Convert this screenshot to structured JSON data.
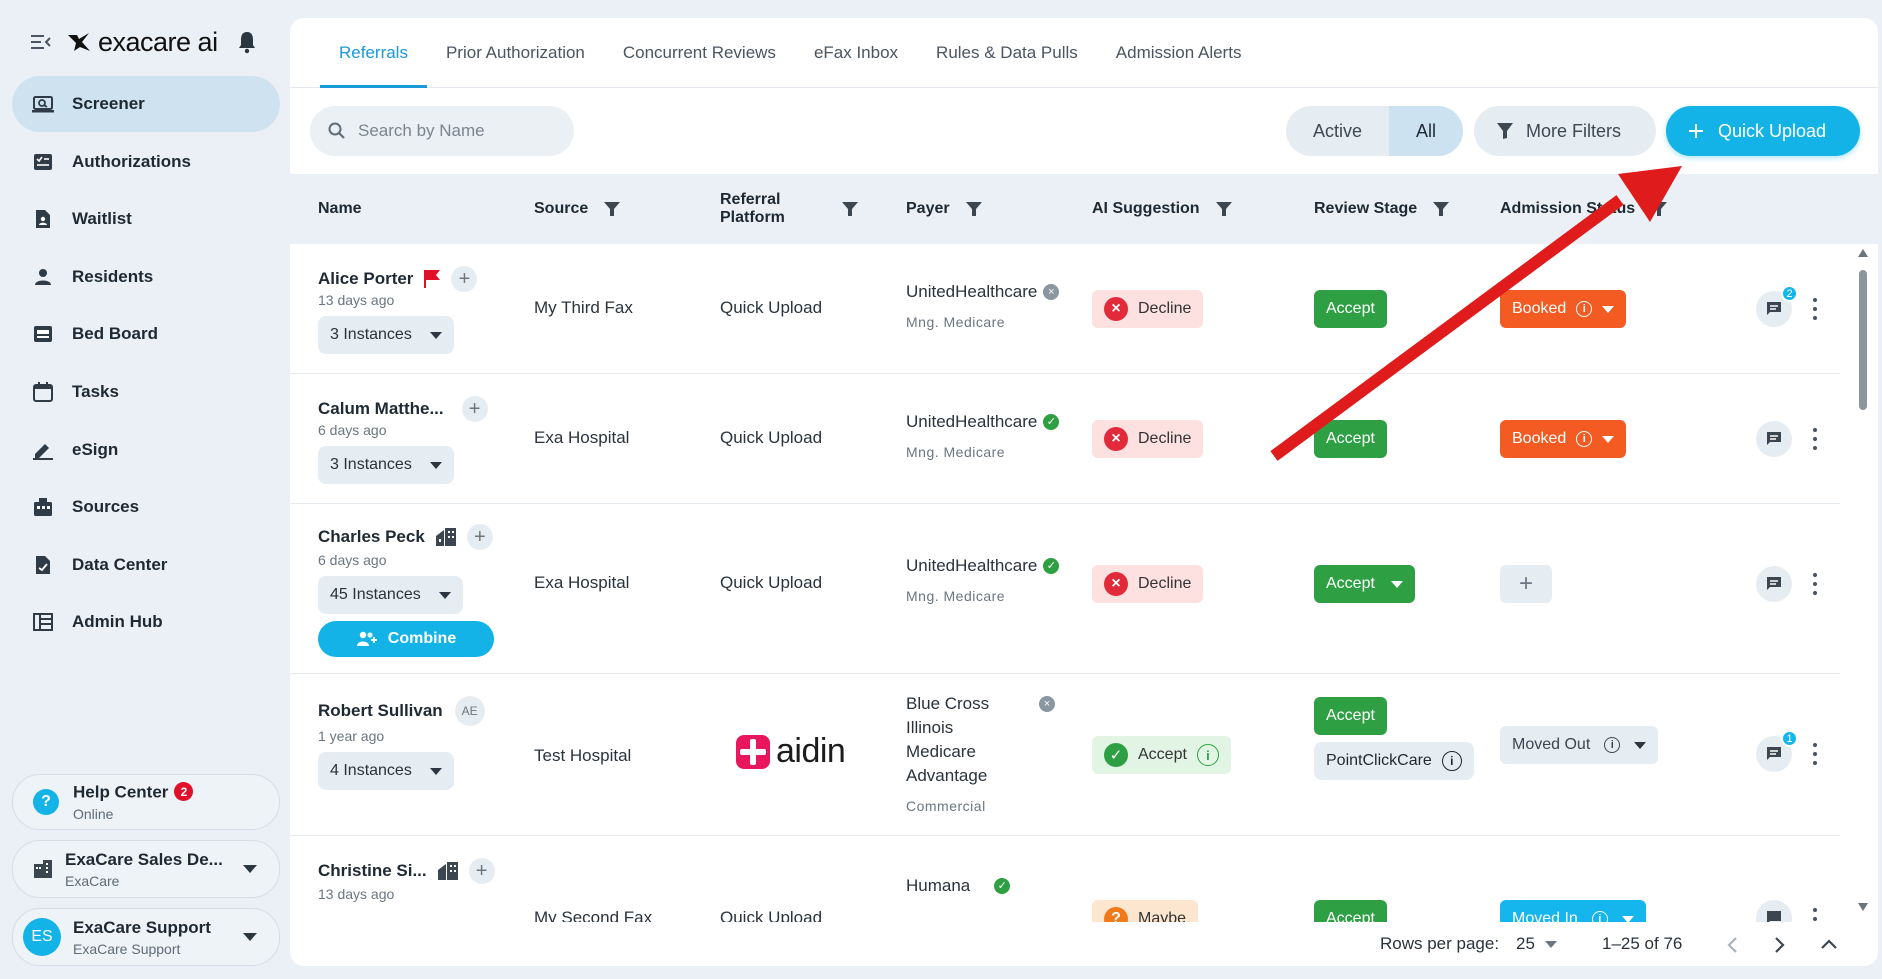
{
  "app": {
    "brand": "exacare ai"
  },
  "sidebar": {
    "items": [
      {
        "label": "Screener",
        "icon": "screener-icon"
      },
      {
        "label": "Authorizations",
        "icon": "authorizations-icon"
      },
      {
        "label": "Waitlist",
        "icon": "waitlist-icon"
      },
      {
        "label": "Residents",
        "icon": "residents-icon"
      },
      {
        "label": "Bed Board",
        "icon": "bed-board-icon"
      },
      {
        "label": "Tasks",
        "icon": "tasks-icon"
      },
      {
        "label": "eSign",
        "icon": "esign-icon"
      },
      {
        "label": "Sources",
        "icon": "sources-icon"
      },
      {
        "label": "Data Center",
        "icon": "data-center-icon"
      },
      {
        "label": "Admin Hub",
        "icon": "admin-hub-icon"
      }
    ],
    "help": {
      "title": "Help Center",
      "badge": "2",
      "status": "Online"
    },
    "org": {
      "title": "ExaCare Sales De...",
      "sub": "ExaCare"
    },
    "user": {
      "initials": "ES",
      "title": "ExaCare Support",
      "sub": "ExaCare Support"
    }
  },
  "tabs": [
    "Referrals",
    "Prior Authorization",
    "Concurrent Reviews",
    "eFax Inbox",
    "Rules & Data Pulls",
    "Admission Alerts"
  ],
  "toolbar": {
    "search_placeholder": "Search by Name",
    "seg_active": "Active",
    "seg_all": "All",
    "more_filters": "More Filters",
    "quick_upload": "Quick Upload"
  },
  "table": {
    "headers": {
      "name": "Name",
      "source": "Source",
      "platform": "Referral Platform",
      "payer": "Payer",
      "ai": "AI Suggestion",
      "stage": "Review Stage",
      "admission": "Admission Status"
    },
    "rows": [
      {
        "name": "Alice Porter",
        "ago": "13 days ago",
        "instances": "3 Instances",
        "source": "My Third Fax",
        "platform": "Quick Upload",
        "payer": "UnitedHealthcare",
        "payer_sub": "Mng. Medicare",
        "ai": "Decline",
        "stage": "Accept",
        "admission": "Booked",
        "comments": "2"
      },
      {
        "name": "Calum Matthe...",
        "ago": "6 days ago",
        "instances": "3 Instances",
        "source": "Exa Hospital",
        "platform": "Quick Upload",
        "payer": "UnitedHealthcare",
        "payer_sub": "Mng. Medicare",
        "ai": "Decline",
        "stage": "Accept",
        "admission": "Booked"
      },
      {
        "name": "Charles Peck",
        "ago": "6 days ago",
        "instances": "45 Instances",
        "combine": "Combine",
        "source": "Exa Hospital",
        "platform": "Quick Upload",
        "payer": "UnitedHealthcare",
        "payer_sub": "Mng. Medicare",
        "ai": "Decline",
        "stage": "Accept"
      },
      {
        "name": "Robert Sullivan",
        "badge": "AE",
        "ago": "1 year ago",
        "instances": "4 Instances",
        "source": "Test Hospital",
        "platform_logo": "aidin",
        "payer_lines": [
          "Blue Cross",
          "Illinois",
          "Medicare",
          "Advantage"
        ],
        "payer_sub": "Commercial",
        "ai": "Accept",
        "stage": "Accept",
        "stage_sub": "PointClickCare",
        "admission": "Moved Out",
        "comments": "1"
      },
      {
        "name": "Christine Si...",
        "ago": "13 days ago",
        "source": "My Second Fax",
        "platform": "Quick Upload",
        "payer": "Humana",
        "ai": "Maybe",
        "stage": "Accept",
        "admission": "Moved In"
      }
    ]
  },
  "footer": {
    "rows_label": "Rows per page:",
    "rows_value": "25",
    "range": "1–25 of 76"
  },
  "colors": {
    "accent": "#13b3e8",
    "accept": "#2ea043",
    "booked": "#f35b22",
    "decline_bg": "#fde0e0",
    "annotation_arrow": "#e01b1b"
  }
}
